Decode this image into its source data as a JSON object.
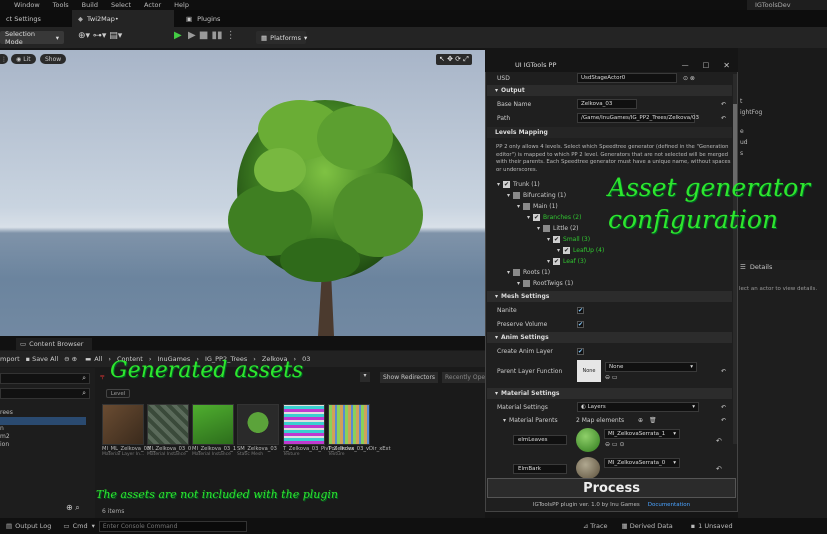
{
  "menu": [
    "Window",
    "Tools",
    "Build",
    "Select",
    "Actor",
    "Help"
  ],
  "project_name": "IGToolsDev",
  "tabs": {
    "settings": "ct Settings",
    "level": "Twi2Map•",
    "plugins": "Plugins"
  },
  "toolbar": {
    "mode": "Selection Mode",
    "platforms": "Platforms"
  },
  "viewport": {
    "lit": "Lit",
    "show": "Show"
  },
  "content_browser": {
    "tab": "Content Browser",
    "import": "mport",
    "save_all": "Save All",
    "breadcrumb": [
      "All",
      "Content",
      "InuGames",
      "IG_PP2_Trees",
      "Zelkova",
      "03"
    ],
    "show_redirectors": "Show Redirectors",
    "recently_opened": "Recently Ope",
    "filter_chip": "Level",
    "item_count": "6 items",
    "folders": [
      "rees",
      "n",
      "m2",
      "ion"
    ],
    "assets": [
      {
        "name": "MI_ML_Zelkova_03_...",
        "type": "Material Layer In..."
      },
      {
        "name": "MI_Zelkova_03_0",
        "type": "Material Instance"
      },
      {
        "name": "MI_Zelkova_03_1",
        "type": "Material Instance"
      },
      {
        "name": "SM_Zelkova_03",
        "type": "Static Mesh"
      },
      {
        "name": "T_Zelkova_03_PivPos_Index",
        "type": "Texture"
      },
      {
        "name": "T_Zelkova_03_vDir_xExt",
        "type": "Texture"
      }
    ]
  },
  "status": {
    "output_log": "Output Log",
    "cmd": "Cmd",
    "console_placeholder": "Enter Console Command",
    "trace": "Trace",
    "derived_data": "Derived Data",
    "unsaved": "1 Unsaved"
  },
  "outliner_items": [
    "t",
    "ightFog",
    "e",
    "ud",
    "s"
  ],
  "details": {
    "tab": "Details",
    "hint": "lect an actor to view details."
  },
  "plugin": {
    "title": "UI IGTools PP",
    "usd_label": "USD",
    "usd_value": "UsdStageActor0",
    "output_section": "Output",
    "base_name_label": "Base Name",
    "base_name_value": "Zelkova_03",
    "path_label": "Path",
    "path_value": "/Game/InuGames/IG_PP2_Trees/Zelkova/03",
    "levels_section": "Levels Mapping",
    "levels_note": "PP 2 only allows 4 levels. Select which Speedtree generator (defined in the \"Generation editor\") is mapped to which PP 2 level. Generators that are not selected will be merged with their parents. Each Speedtree generator must have a unique name, without spaces or underscores.",
    "tree": [
      {
        "label": "Trunk (1)",
        "indent": 0,
        "green": false,
        "color": "#cfcfcf",
        "checked": true
      },
      {
        "label": "Bifurcating (1)",
        "indent": 1,
        "green": false,
        "color": "#8a8a8a",
        "checked": false
      },
      {
        "label": "Main (1)",
        "indent": 2,
        "green": false,
        "color": "#8a8a8a",
        "checked": false
      },
      {
        "label": "Branches (2)",
        "indent": 3,
        "green": true,
        "color": "#cfcfcf",
        "checked": true
      },
      {
        "label": "Little (2)",
        "indent": 4,
        "green": false,
        "color": "#8a8a8a",
        "checked": false
      },
      {
        "label": "Small (3)",
        "indent": 5,
        "green": true,
        "color": "#cfcfcf",
        "checked": true
      },
      {
        "label": "LeafUp (4)",
        "indent": 6,
        "green": true,
        "color": "#cfcfcf",
        "checked": true
      },
      {
        "label": "Leaf (3)",
        "indent": 5,
        "green": true,
        "color": "#cfcfcf",
        "checked": true
      },
      {
        "label": "Roots (1)",
        "indent": 1,
        "green": false,
        "color": "#8a8a8a",
        "checked": false
      },
      {
        "label": "RootTwigs (1)",
        "indent": 2,
        "green": false,
        "color": "#8a8a8a",
        "checked": false
      }
    ],
    "mesh_section": "Mesh Settings",
    "nanite_label": "Nanite",
    "preserve_volume_label": "Preserve Volume",
    "anim_section": "Anim Settings",
    "create_anim_layer_label": "Create Anim Layer",
    "parent_layer_function_label": "Parent Layer Function",
    "none_thumb": "None",
    "none_value": "None",
    "material_section": "Material Settings",
    "material_settings_label": "Material Settings",
    "layers_value": "Layers",
    "material_parents_label": "Material Parents",
    "map_elements": "2 Map elements",
    "elm_leaves": "elmLeaves",
    "elm_leaves_mat": "MI_ZelkovaSerrata_1",
    "elm_bark": "ElmBark",
    "elm_bark_mat": "MI_ZelkovaSerrata_0",
    "process": "Process",
    "footer_text": "IGToolsPP plugin ver. 1.0 by Inu Games",
    "footer_link": "Documentation"
  },
  "annotations": {
    "asset_gen_line1": "Asset generator",
    "asset_gen_line2": "configuration",
    "generated_assets": "Generated assets",
    "not_included": "The assets are not included with the plugin"
  }
}
